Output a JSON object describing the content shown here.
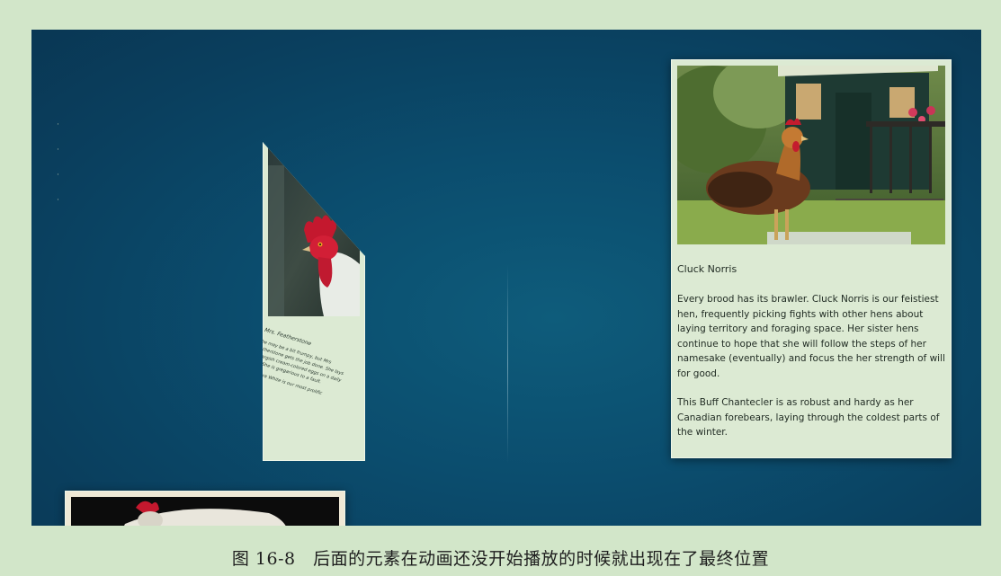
{
  "cards": {
    "right": {
      "title": "Cluck Norris",
      "paragraph1": "Every brood has its brawler. Cluck Norris is our feistiest hen, frequently picking fights with other hens about laying territory and foraging space. Her sister hens continue to hope that she will follow the steps of her namesake (eventually) and focus the her strength of will for good.",
      "paragraph2": "This Buff Chantecler is as robust and hardy as her Canadian forebears, laying through the coldest parts of the winter."
    },
    "left": {
      "title": "Mrs. Featherstone",
      "paragraph1": "She may be a bit frumpy, but Mrs Featherstone gets the job done. She lays her largish cream-colored eggs on a daily basis. She is gregarious to a fault.",
      "paragraph2": "This Austra White is our most prolific producer."
    }
  },
  "caption": "图 16-8　后面的元素在动画还没开始播放的时候就出现在了最终位置",
  "colors": {
    "page_background": "#d2e6c9",
    "stage_background": "#0b4d6e",
    "card_background": "#dcead3"
  }
}
